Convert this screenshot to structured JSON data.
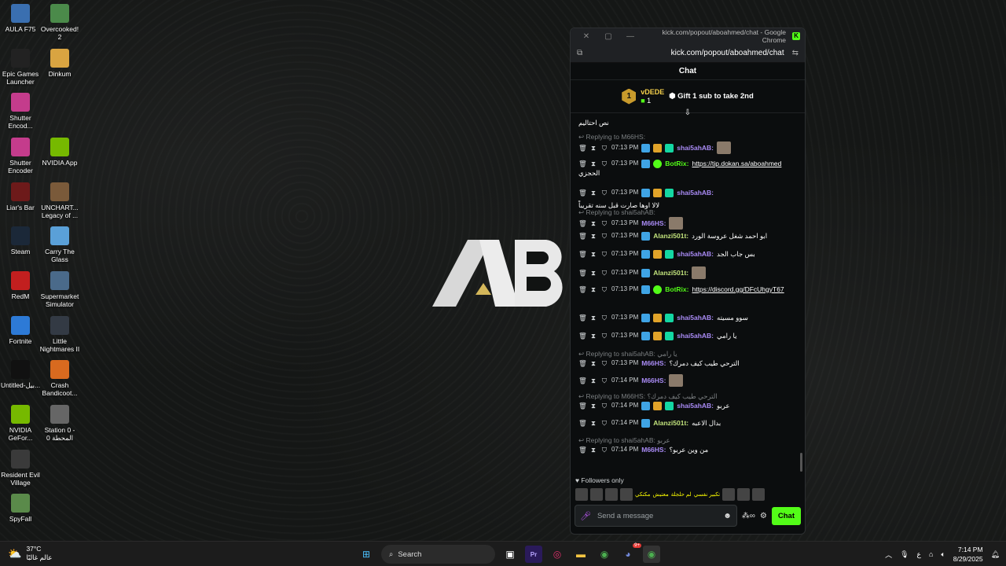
{
  "desktop": {
    "icons": [
      {
        "label": "AULA F75",
        "color": "#3a6fb0"
      },
      {
        "label": "Overcooked! 2",
        "color": "#4b8a4a"
      },
      {
        "label": "Epic Games Launcher",
        "color": "#222222"
      },
      {
        "label": "Dinkum",
        "color": "#d9a441"
      },
      {
        "label": "Shutter Encod...",
        "color": "#c43c8c"
      },
      {
        "label": "Shutter Encoder",
        "color": "#c43c8c"
      },
      {
        "label": "NVIDIA App",
        "color": "#76b900"
      },
      {
        "label": "Liar's Bar",
        "color": "#6d1a1a"
      },
      {
        "label": "UNCHART... Legacy of ...",
        "color": "#7a5a3a"
      },
      {
        "label": "Steam",
        "color": "#1b2838"
      },
      {
        "label": "Carry The Glass",
        "color": "#5aa0d8"
      },
      {
        "label": "RedM",
        "color": "#c21f1f"
      },
      {
        "label": "Supermarket Simulator",
        "color": "#4a6a8a"
      },
      {
        "label": "Fortnite",
        "color": "#2d7ad6"
      },
      {
        "label": "Little Nightmares II",
        "color": "#333a44"
      },
      {
        "label": "Untitled-بيل...",
        "color": "#111111"
      },
      {
        "label": "Crash Bandicoot...",
        "color": "#d86a1f"
      },
      {
        "label": "NVIDIA GeFor...",
        "color": "#76b900"
      },
      {
        "label": "Station 0 - المحطة 0",
        "color": "#666666"
      },
      {
        "label": "Resident Evil Village",
        "color": "#3a3a3a"
      },
      {
        "label": "SpyFall",
        "color": "#5a8a4a"
      }
    ]
  },
  "window": {
    "title": "kick.com/popout/aboahmed/chat - Google Chrome",
    "url": "kick.com/popout/aboahmed/chat",
    "chat_title": "Chat"
  },
  "pinned": {
    "rank": "1",
    "user": "vDEDE",
    "count": "1",
    "gift_text": "Gift 1 sub to take 2nd"
  },
  "messages": [
    {
      "text": "نص احتاليم"
    },
    {
      "reply": "Replying to M66HS:",
      "time": "07:13 PM",
      "user": "shai5ahAB:",
      "color": "#a98bf5"
    },
    {
      "time": "07:13 PM",
      "user": "BotRix:",
      "color": "#53fc18",
      "link": "https://tip.dokan.sa/aboahmed",
      "extra": "الحجزي"
    },
    {
      "time": "07:13 PM",
      "user": "shai5ahAB:",
      "color": "#a98bf5",
      "text": "لالا اوها صارت قبل سنه تقريباً"
    },
    {
      "reply": "Replying to shai5ahAB:",
      "time": "07:13 PM",
      "user": "M66HS:",
      "color": "#a98bf5"
    },
    {
      "time": "07:13 PM",
      "user": "Alanzi501t:",
      "color": "#c2e37c",
      "text": "ابو احمد شغل عروسة الورد"
    },
    {
      "time": "07:13 PM",
      "user": "shai5ahAB:",
      "color": "#a98bf5",
      "text": "بس جاب الجد"
    },
    {
      "time": "07:13 PM",
      "user": "Alanzi501t:",
      "color": "#c2e37c"
    },
    {
      "time": "07:13 PM",
      "user": "BotRix:",
      "color": "#53fc18",
      "link": "https://discord.gg/DFcUhgyT67"
    },
    {
      "time": "07:13 PM",
      "user": "shai5ahAB:",
      "color": "#a98bf5",
      "text": "سوو مسيته"
    },
    {
      "time": "07:13 PM",
      "user": "shai5ahAB:",
      "color": "#a98bf5",
      "text": "يا رامي"
    },
    {
      "reply": "Replying to shai5ahAB: يا رامي",
      "time": "07:13 PM",
      "user": "M66HS:",
      "color": "#a98bf5",
      "text": "الترحي طيب كيف دمرك؟"
    },
    {
      "time": "07:14 PM",
      "user": "M66HS:",
      "color": "#a98bf5"
    },
    {
      "reply": "Replying to M66HS: الترحي طيب كيف دمرك؟",
      "time": "07:14 PM",
      "user": "shai5ahAB:",
      "color": "#a98bf5",
      "text": "عربو"
    },
    {
      "time": "07:14 PM",
      "user": "Alanzi501t:",
      "color": "#c2e37c",
      "text": "بدال الاعبه"
    },
    {
      "reply": "Replying to shai5ahAB: عربو",
      "time": "07:14 PM",
      "user": "M66HS:",
      "color": "#a98bf5",
      "text": "من وين عربو؟"
    }
  ],
  "followers_only": "Followers only",
  "emote_labels": [
    "مكتكي",
    "معتيش",
    "لم حلجلة",
    "تكبير نفسي"
  ],
  "input": {
    "placeholder": "Send a message",
    "send": "Chat"
  },
  "taskbar": {
    "temp": "37°C",
    "weather_desc": "عالم غالبًا",
    "search": "Search",
    "lang": "ع",
    "time": "7:14 PM",
    "date": "8/29/2025",
    "discord_badge": "9+"
  },
  "colors": {
    "kick_green": "#53fc18"
  }
}
